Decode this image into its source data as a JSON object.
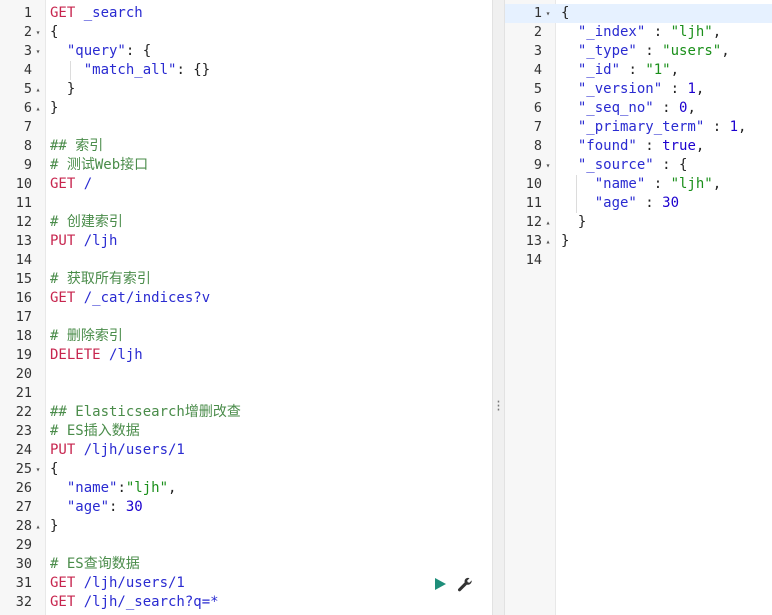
{
  "console": {
    "left_lines": [
      {
        "num": "1",
        "fold": "",
        "parts": [
          {
            "c": "method",
            "t": "GET "
          },
          {
            "c": "path",
            "t": "_search"
          }
        ]
      },
      {
        "num": "2",
        "fold": "▾",
        "parts": [
          {
            "c": "punct",
            "t": "{"
          }
        ]
      },
      {
        "num": "3",
        "fold": "▾",
        "parts": [
          {
            "c": "punct",
            "t": "  "
          },
          {
            "c": "key",
            "t": "\"query\""
          },
          {
            "c": "punct",
            "t": ": {"
          }
        ]
      },
      {
        "num": "4",
        "fold": "",
        "parts": [
          {
            "c": "punct",
            "t": "    "
          },
          {
            "c": "key",
            "t": "\"match_all\""
          },
          {
            "c": "punct",
            "t": ": {}"
          }
        ]
      },
      {
        "num": "5",
        "fold": "▴",
        "parts": [
          {
            "c": "punct",
            "t": "  }"
          }
        ]
      },
      {
        "num": "6",
        "fold": "▴",
        "parts": [
          {
            "c": "punct",
            "t": "}"
          }
        ]
      },
      {
        "num": "7",
        "fold": "",
        "parts": []
      },
      {
        "num": "8",
        "fold": "",
        "parts": [
          {
            "c": "comment",
            "t": "## 索引"
          }
        ]
      },
      {
        "num": "9",
        "fold": "",
        "parts": [
          {
            "c": "comment",
            "t": "# 测试Web接口"
          }
        ]
      },
      {
        "num": "10",
        "fold": "",
        "parts": [
          {
            "c": "method",
            "t": "GET "
          },
          {
            "c": "path",
            "t": "/"
          }
        ]
      },
      {
        "num": "11",
        "fold": "",
        "parts": []
      },
      {
        "num": "12",
        "fold": "",
        "parts": [
          {
            "c": "comment",
            "t": "# 创建索引"
          }
        ]
      },
      {
        "num": "13",
        "fold": "",
        "parts": [
          {
            "c": "method",
            "t": "PUT "
          },
          {
            "c": "path",
            "t": "/ljh"
          }
        ]
      },
      {
        "num": "14",
        "fold": "",
        "parts": []
      },
      {
        "num": "15",
        "fold": "",
        "parts": [
          {
            "c": "comment",
            "t": "# 获取所有索引"
          }
        ]
      },
      {
        "num": "16",
        "fold": "",
        "parts": [
          {
            "c": "method",
            "t": "GET "
          },
          {
            "c": "path",
            "t": "/_cat/indices?v"
          }
        ]
      },
      {
        "num": "17",
        "fold": "",
        "parts": []
      },
      {
        "num": "18",
        "fold": "",
        "parts": [
          {
            "c": "comment",
            "t": "# 删除索引"
          }
        ]
      },
      {
        "num": "19",
        "fold": "",
        "parts": [
          {
            "c": "method",
            "t": "DELETE "
          },
          {
            "c": "path",
            "t": "/ljh"
          }
        ]
      },
      {
        "num": "20",
        "fold": "",
        "parts": []
      },
      {
        "num": "21",
        "fold": "",
        "parts": []
      },
      {
        "num": "22",
        "fold": "",
        "parts": [
          {
            "c": "comment",
            "t": "## Elasticsearch增删改查"
          }
        ]
      },
      {
        "num": "23",
        "fold": "",
        "parts": [
          {
            "c": "comment",
            "t": "# ES插入数据"
          }
        ]
      },
      {
        "num": "24",
        "fold": "",
        "parts": [
          {
            "c": "method",
            "t": "PUT "
          },
          {
            "c": "path",
            "t": "/ljh/users/1"
          }
        ]
      },
      {
        "num": "25",
        "fold": "▾",
        "parts": [
          {
            "c": "punct",
            "t": "{"
          }
        ]
      },
      {
        "num": "26",
        "fold": "",
        "parts": [
          {
            "c": "punct",
            "t": "  "
          },
          {
            "c": "key",
            "t": "\"name\""
          },
          {
            "c": "punct",
            "t": ":"
          },
          {
            "c": "str",
            "t": "\"ljh\""
          },
          {
            "c": "punct",
            "t": ","
          }
        ]
      },
      {
        "num": "27",
        "fold": "",
        "parts": [
          {
            "c": "punct",
            "t": "  "
          },
          {
            "c": "key",
            "t": "\"age\""
          },
          {
            "c": "punct",
            "t": ": "
          },
          {
            "c": "num",
            "t": "30"
          }
        ]
      },
      {
        "num": "28",
        "fold": "▴",
        "parts": [
          {
            "c": "punct",
            "t": "}"
          }
        ]
      },
      {
        "num": "29",
        "fold": "",
        "parts": []
      },
      {
        "num": "30",
        "fold": "",
        "parts": [
          {
            "c": "comment",
            "t": "# ES查询数据"
          }
        ]
      },
      {
        "num": "31",
        "fold": "",
        "parts": [
          {
            "c": "method",
            "t": "GET "
          },
          {
            "c": "path",
            "t": "/ljh/users/1"
          }
        ]
      },
      {
        "num": "32",
        "fold": "",
        "parts": [
          {
            "c": "method",
            "t": "GET "
          },
          {
            "c": "path",
            "t": "/ljh/_search?q=*"
          }
        ]
      }
    ],
    "right_lines": [
      {
        "num": "1",
        "fold": "▾",
        "parts": [
          {
            "c": "punct",
            "t": "{"
          }
        ]
      },
      {
        "num": "2",
        "fold": "",
        "parts": [
          {
            "c": "punct",
            "t": "  "
          },
          {
            "c": "key",
            "t": "\"_index\""
          },
          {
            "c": "punct",
            "t": " : "
          },
          {
            "c": "str",
            "t": "\"ljh\""
          },
          {
            "c": "punct",
            "t": ","
          }
        ]
      },
      {
        "num": "3",
        "fold": "",
        "parts": [
          {
            "c": "punct",
            "t": "  "
          },
          {
            "c": "key",
            "t": "\"_type\""
          },
          {
            "c": "punct",
            "t": " : "
          },
          {
            "c": "str",
            "t": "\"users\""
          },
          {
            "c": "punct",
            "t": ","
          }
        ]
      },
      {
        "num": "4",
        "fold": "",
        "parts": [
          {
            "c": "punct",
            "t": "  "
          },
          {
            "c": "key",
            "t": "\"_id\""
          },
          {
            "c": "punct",
            "t": " : "
          },
          {
            "c": "str",
            "t": "\"1\""
          },
          {
            "c": "punct",
            "t": ","
          }
        ]
      },
      {
        "num": "5",
        "fold": "",
        "parts": [
          {
            "c": "punct",
            "t": "  "
          },
          {
            "c": "key",
            "t": "\"_version\""
          },
          {
            "c": "punct",
            "t": " : "
          },
          {
            "c": "num",
            "t": "1"
          },
          {
            "c": "punct",
            "t": ","
          }
        ]
      },
      {
        "num": "6",
        "fold": "",
        "parts": [
          {
            "c": "punct",
            "t": "  "
          },
          {
            "c": "key",
            "t": "\"_seq_no\""
          },
          {
            "c": "punct",
            "t": " : "
          },
          {
            "c": "num",
            "t": "0"
          },
          {
            "c": "punct",
            "t": ","
          }
        ]
      },
      {
        "num": "7",
        "fold": "",
        "parts": [
          {
            "c": "punct",
            "t": "  "
          },
          {
            "c": "key",
            "t": "\"_primary_term\""
          },
          {
            "c": "punct",
            "t": " : "
          },
          {
            "c": "num",
            "t": "1"
          },
          {
            "c": "punct",
            "t": ","
          }
        ]
      },
      {
        "num": "8",
        "fold": "",
        "parts": [
          {
            "c": "punct",
            "t": "  "
          },
          {
            "c": "key",
            "t": "\"found\""
          },
          {
            "c": "punct",
            "t": " : "
          },
          {
            "c": "bool",
            "t": "true"
          },
          {
            "c": "punct",
            "t": ","
          }
        ]
      },
      {
        "num": "9",
        "fold": "▾",
        "parts": [
          {
            "c": "punct",
            "t": "  "
          },
          {
            "c": "key",
            "t": "\"_source\""
          },
          {
            "c": "punct",
            "t": " : {"
          }
        ]
      },
      {
        "num": "10",
        "fold": "",
        "parts": [
          {
            "c": "punct",
            "t": "    "
          },
          {
            "c": "key",
            "t": "\"name\""
          },
          {
            "c": "punct",
            "t": " : "
          },
          {
            "c": "str",
            "t": "\"ljh\""
          },
          {
            "c": "punct",
            "t": ","
          }
        ]
      },
      {
        "num": "11",
        "fold": "",
        "parts": [
          {
            "c": "punct",
            "t": "    "
          },
          {
            "c": "key",
            "t": "\"age\""
          },
          {
            "c": "punct",
            "t": " : "
          },
          {
            "c": "num",
            "t": "30"
          }
        ]
      },
      {
        "num": "12",
        "fold": "▴",
        "parts": [
          {
            "c": "punct",
            "t": "  }"
          }
        ]
      },
      {
        "num": "13",
        "fold": "▴",
        "parts": [
          {
            "c": "punct",
            "t": "}"
          }
        ]
      },
      {
        "num": "14",
        "fold": "",
        "parts": []
      }
    ],
    "icons": {
      "run": "play-icon",
      "settings": "wrench-icon",
      "splitter": "vertical-dots-icon"
    },
    "colors": {
      "method": "#c7254e",
      "path": "#2a2bd1",
      "string": "#1a8f1a",
      "number": "#1c00cf",
      "comment": "#4a8c4a",
      "run_button": "#1e8e7a"
    }
  }
}
